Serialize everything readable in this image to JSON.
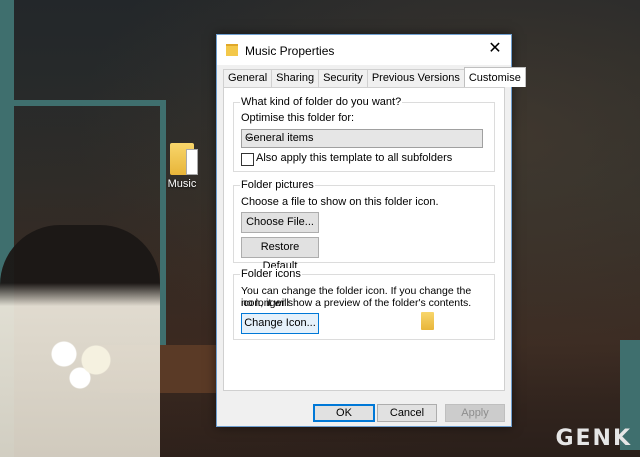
{
  "desktop": {
    "icon_label": "Music",
    "watermark": "GENK"
  },
  "dialog": {
    "title": "Music Properties",
    "close_glyph": "✕",
    "tabs": [
      {
        "label": "General"
      },
      {
        "label": "Sharing"
      },
      {
        "label": "Security"
      },
      {
        "label": "Previous Versions"
      },
      {
        "label": "Customise",
        "active": true
      }
    ],
    "folder_type": {
      "group_title": "What kind of folder do you want?",
      "optimise_label": "Optimise this folder for:",
      "selected": "General items",
      "apply_subfolders_label": "Also apply this template to all subfolders",
      "apply_subfolders_checked": false
    },
    "folder_pictures": {
      "group_title": "Folder pictures",
      "description": "Choose a file to show on this folder icon.",
      "choose_file": "Choose File...",
      "restore_default": "Restore Default"
    },
    "folder_icons": {
      "group_title": "Folder icons",
      "description_line1": "You can change the folder icon. If you change the icon, it will",
      "description_line2": "no longer show a preview of the folder's contents.",
      "change_icon": "Change Icon..."
    },
    "buttons": {
      "ok": "OK",
      "cancel": "Cancel",
      "apply": "Apply"
    }
  },
  "colors": {
    "accent": "#0078d7",
    "annotation_arrow": "#e02020"
  },
  "icons": [
    "folder-icon",
    "close-icon",
    "chevron-down-icon",
    "red-arrow-annotation"
  ]
}
